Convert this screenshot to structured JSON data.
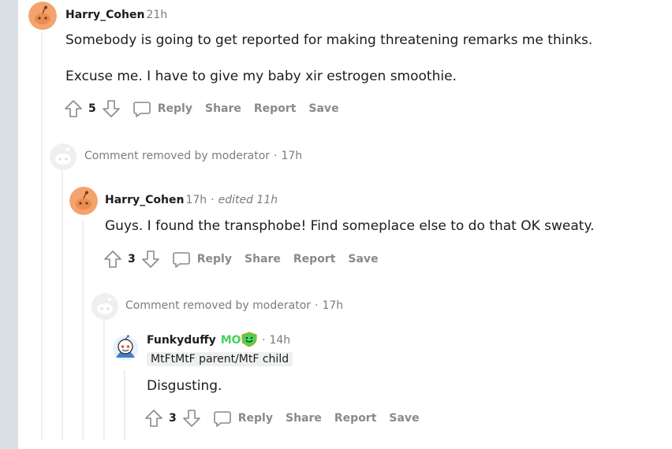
{
  "comments": [
    {
      "username": "Harry_Cohen",
      "time": "21h",
      "paragraphs": [
        "Somebody is going to get reported for making threatening remarks me thinks.",
        "Excuse me. I have to give my baby xir estrogen smoothie."
      ],
      "score": "5"
    },
    {
      "removed_text": "Comment removed by moderator",
      "time": "17h"
    },
    {
      "username": "Harry_Cohen",
      "time": "17h",
      "edited": "edited 11h",
      "paragraphs": [
        "Guys. I found the transphobe! Find someplace else to do that OK sweaty."
      ],
      "score": "3"
    },
    {
      "removed_text": "Comment removed by moderator",
      "time": "17h"
    },
    {
      "username": "Funkyduffy",
      "mod_label": "MOD",
      "time": "14h",
      "flair": "MtFtMtF parent/MtF child",
      "paragraphs": [
        "Disgusting."
      ],
      "score": "3"
    }
  ],
  "actions": {
    "reply": "Reply",
    "share": "Share",
    "report": "Report",
    "save": "Save"
  },
  "icons": {
    "upvote": "upvote-arrow-icon",
    "downvote": "downvote-arrow-icon",
    "reply": "speech-bubble-icon",
    "snoo": "snoo-avatar-icon"
  },
  "colors": {
    "gutter": "#dae0e6",
    "action_gray": "#878a8c",
    "meta_gray": "#7c7c7c",
    "mod_green": "#46d160",
    "avatar_orange": "#f3a36b"
  }
}
